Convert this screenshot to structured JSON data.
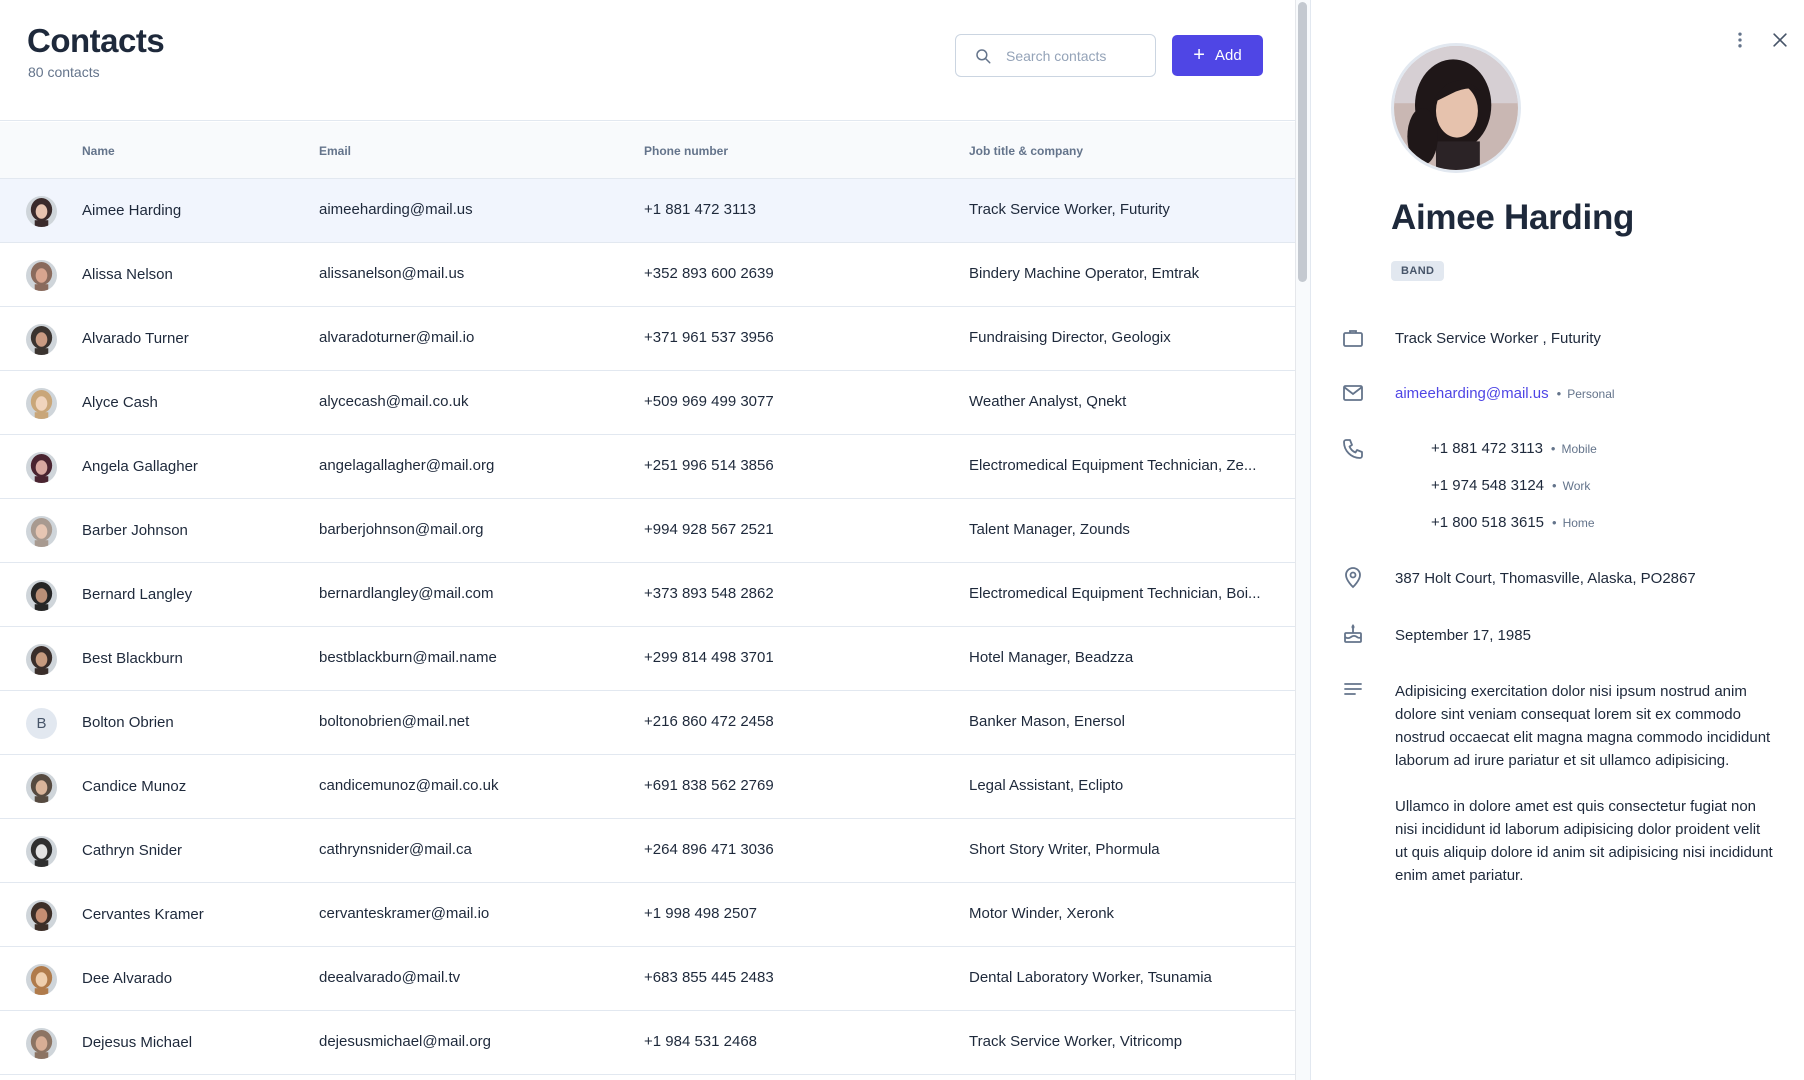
{
  "header": {
    "title": "Contacts",
    "subtitle": "80 contacts",
    "search_placeholder": "Search contacts",
    "add_label": "Add"
  },
  "table": {
    "columns": [
      "Name",
      "Email",
      "Phone number",
      "Job title & company"
    ],
    "rows": [
      {
        "name": "Aimee Harding",
        "email": "aimeeharding@mail.us",
        "phone": "+1 881 472 3113",
        "job": "Track Service Worker,  Futurity"
      },
      {
        "name": "Alissa Nelson",
        "email": "alissanelson@mail.us",
        "phone": "+352 893 600 2639",
        "job": "Bindery Machine Operator,  Emtrak"
      },
      {
        "name": "Alvarado Turner",
        "email": "alvaradoturner@mail.io",
        "phone": "+371 961 537 3956",
        "job": "Fundraising Director,  Geologix"
      },
      {
        "name": "Alyce Cash",
        "email": "alycecash@mail.co.uk",
        "phone": "+509 969 499 3077",
        "job": "Weather Analyst,  Qnekt"
      },
      {
        "name": "Angela Gallagher",
        "email": "angelagallagher@mail.org",
        "phone": "+251 996 514 3856",
        "job": "Electromedical Equipment Technician,  Ze..."
      },
      {
        "name": "Barber Johnson",
        "email": "barberjohnson@mail.org",
        "phone": "+994 928 567 2521",
        "job": "Talent Manager,  Zounds"
      },
      {
        "name": "Bernard Langley",
        "email": "bernardlangley@mail.com",
        "phone": "+373 893 548 2862",
        "job": "Electromedical Equipment Technician,  Boi..."
      },
      {
        "name": "Best Blackburn",
        "email": "bestblackburn@mail.name",
        "phone": "+299 814 498 3701",
        "job": "Hotel Manager,  Beadzza"
      },
      {
        "name": "Bolton Obrien",
        "email": "boltonobrien@mail.net",
        "phone": "+216 860 472 2458",
        "job": "Banker Mason,  Enersol",
        "initial": "B"
      },
      {
        "name": "Candice Munoz",
        "email": "candicemunoz@mail.co.uk",
        "phone": "+691 838 562 2769",
        "job": "Legal Assistant,  Eclipto"
      },
      {
        "name": "Cathryn Snider",
        "email": "cathrynsnider@mail.ca",
        "phone": "+264 896 471 3036",
        "job": "Short Story Writer,  Phormula"
      },
      {
        "name": "Cervantes Kramer",
        "email": "cervanteskramer@mail.io",
        "phone": "+1 998 498 2507",
        "job": "Motor Winder,  Xeronk"
      },
      {
        "name": "Dee Alvarado",
        "email": "deealvarado@mail.tv",
        "phone": "+683 855 445 2483",
        "job": "Dental Laboratory Worker,  Tsunamia"
      },
      {
        "name": "Dejesus Michael",
        "email": "dejesusmichael@mail.org",
        "phone": "+1 984 531 2468",
        "job": "Track Service Worker,  Vitricomp"
      }
    ]
  },
  "detail": {
    "name": "Aimee Harding",
    "tag": "BAND",
    "job": "Track Service Worker , Futurity",
    "email": "aimeeharding@mail.us",
    "email_label": "Personal",
    "phones": [
      {
        "number": "+1 881 472 3113",
        "label": "Mobile"
      },
      {
        "number": "+1 974 548 3124",
        "label": "Work"
      },
      {
        "number": "+1 800 518 3615",
        "label": "Home"
      }
    ],
    "address": "387 Holt Court, Thomasville, Alaska, PO2867",
    "birthday": "September 17, 1985",
    "notes": [
      "Adipisicing exercitation dolor nisi ipsum nostrud anim dolore sint veniam consequat lorem sit ex commodo nostrud occaecat elit magna magna commodo incididunt laborum ad irure pariatur et sit ullamco adipisicing.",
      "Ullamco in dolore amet est quis consectetur fugiat non nisi incididunt id laborum adipisicing dolor proident velit ut quis aliquip dolore id anim sit adipisicing nisi incididunt enim amet pariatur."
    ]
  },
  "icons": {
    "search": "search-icon",
    "add": "plus-icon",
    "more": "more-vertical-icon",
    "close": "close-icon",
    "job": "briefcase-icon",
    "email": "mail-icon",
    "phone": "phone-icon",
    "address": "map-pin-icon",
    "birthday": "cake-icon",
    "notes": "notes-icon"
  },
  "colors": {
    "accent": "#4f46e5",
    "selected_row": "#f1f5fd",
    "border": "#e2e8f0"
  }
}
